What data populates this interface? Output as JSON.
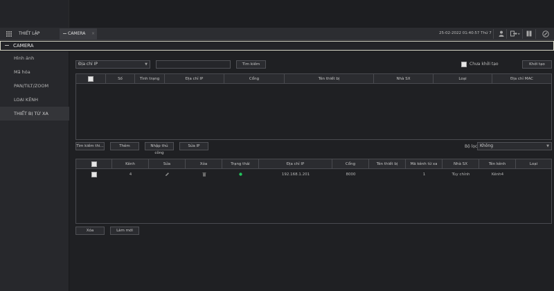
{
  "menubar": {
    "title": "THIẾT LẬP",
    "tab": "CAMERA",
    "tab_close": "×",
    "datetime": "25-02-2022 01:40:57 Thứ 7",
    "icons": [
      "user-icon",
      "logout-icon",
      "split-icon",
      "settings-icon"
    ]
  },
  "section": {
    "title": "CAMERA"
  },
  "sidebar": {
    "items": [
      {
        "label": "Hình ảnh"
      },
      {
        "label": "Mã hóa"
      },
      {
        "label": "PAN/TILT/ZOOM"
      },
      {
        "label": "LOẠI KÊNH"
      },
      {
        "label": "THIẾT BỊ TỪ XA"
      }
    ]
  },
  "search": {
    "select_value": "Địa chỉ IP",
    "search_button": "Tìm kiếm",
    "uninit_label": "Chưa khởi tạo",
    "init_button": "Khởi tạo"
  },
  "device_table": {
    "headers": [
      "",
      "Số",
      "Tình trạng",
      "Địa chỉ IP",
      "Cổng",
      "Tên thiết bị",
      "Nhà SX",
      "Loại",
      "Địa chỉ MAC"
    ]
  },
  "actions": {
    "search_device": "Tìm kiếm thi...",
    "add": "Thêm",
    "manual_add": "Nhập thủ công",
    "edit_ip": "Sửa IP",
    "filter_label": "Bộ lọc",
    "filter_value": "Không"
  },
  "added_table": {
    "headers": [
      "",
      "Kênh",
      "Sửa",
      "Xóa",
      "Trạng thái",
      "Địa chỉ IP",
      "Cổng",
      "Tên thiết bị",
      "Mã kênh từ xa",
      "Nhà SX",
      "Tên kênh",
      "Loại"
    ],
    "rows": [
      {
        "channel": "4",
        "ip": "192.168.1.201",
        "port": "8000",
        "device_name": "",
        "remote_channel": "1",
        "vendor": "Tùy chỉnh",
        "channel_name": "Kênh4",
        "type": ""
      }
    ]
  },
  "bottom": {
    "delete": "Xóa",
    "refresh": "Làm mới"
  },
  "colors": {
    "status_online": "#22c55e"
  }
}
